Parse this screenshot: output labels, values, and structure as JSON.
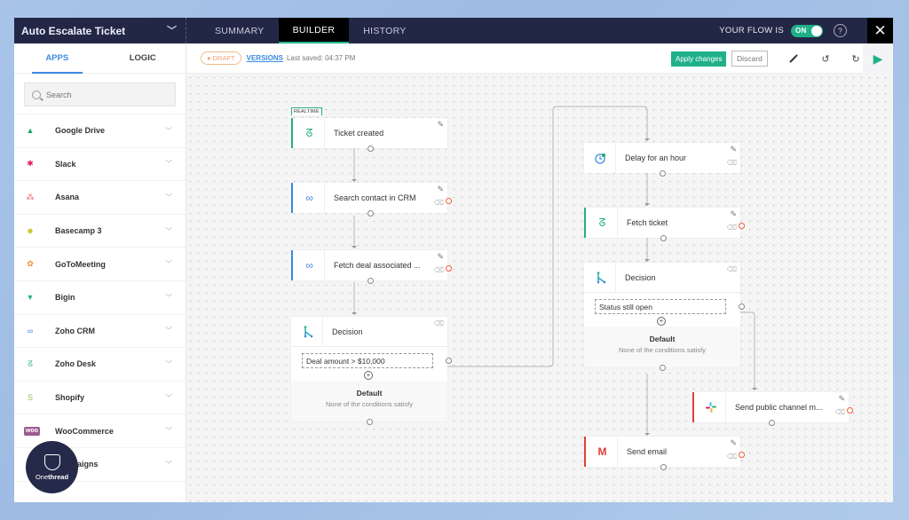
{
  "header": {
    "flow_name": "Auto Escalate Ticket",
    "tabs": [
      {
        "label": "SUMMARY",
        "active": false
      },
      {
        "label": "BUILDER",
        "active": true
      },
      {
        "label": "HISTORY",
        "active": false
      }
    ],
    "flow_status_label": "YOUR FLOW IS",
    "toggle_label": "ON",
    "toggle_on": true,
    "help_icon": "?",
    "close_icon": "✕"
  },
  "sidebar": {
    "tabs": [
      {
        "label": "APPS",
        "active": true
      },
      {
        "label": "LOGIC",
        "active": false
      }
    ],
    "search_placeholder": "Search",
    "apps": [
      {
        "label": "Google Drive",
        "icon": "google-drive-icon",
        "glyph": "▲",
        "color": "#1fa463"
      },
      {
        "label": "Slack",
        "icon": "slack-icon",
        "glyph": "✱",
        "color": "#e01e5a"
      },
      {
        "label": "Asana",
        "icon": "asana-icon",
        "glyph": "⁂",
        "color": "#f06a6a"
      },
      {
        "label": "Basecamp 3",
        "icon": "basecamp-icon",
        "glyph": "☻",
        "color": "#c7c21b"
      },
      {
        "label": "GoToMeeting",
        "icon": "gotomeeting-icon",
        "glyph": "✿",
        "color": "#f68d2e"
      },
      {
        "label": "Bigin",
        "icon": "bigin-icon",
        "glyph": "▼",
        "color": "#2fb574"
      },
      {
        "label": "Zoho CRM",
        "icon": "zoho-crm-icon",
        "glyph": "∞",
        "color": "#3b8be0"
      },
      {
        "label": "Zoho Desk",
        "icon": "zoho-desk-icon",
        "glyph": "ᘔ",
        "color": "#25b07a"
      },
      {
        "label": "Shopify",
        "icon": "shopify-icon",
        "glyph": "S",
        "color": "#95bf47"
      },
      {
        "label": "WooCommerce",
        "icon": "woocommerce-icon",
        "glyph": "woo",
        "color": "#9b5c8f"
      },
      {
        "label": "Campaigns",
        "icon": "campaigns-icon",
        "glyph": "●",
        "color": "#e0413a"
      }
    ]
  },
  "toolbar": {
    "draft_label": "● DRAFT",
    "versions_label": "VERSIONS",
    "last_saved": "Last saved: 04:37 PM",
    "apply_label": "Apply changes",
    "discard_label": "Discard",
    "magic_icon": "⁄",
    "undo_icon": "↺",
    "redo_icon": "↻",
    "run_icon": "▶"
  },
  "flow": {
    "trigger": {
      "tag": "REALTIME",
      "label": "Ticket created",
      "glyph": "ᘔ",
      "color": "#25b07a"
    },
    "nodes": [
      {
        "id": "search-contact",
        "label": "Search contact in CRM",
        "glyph": "∞",
        "color": "#3b8be0"
      },
      {
        "id": "fetch-deal",
        "label": "Fetch deal associated ...",
        "glyph": "∞",
        "color": "#3b8be0"
      },
      {
        "id": "delay",
        "label": "Delay for an hour",
        "glyph": "◔",
        "color": "#3b8be0"
      },
      {
        "id": "fetch-ticket",
        "label": "Fetch ticket",
        "glyph": "ᘔ",
        "color": "#25b07a"
      },
      {
        "id": "send-slack",
        "label": "Send public channel m...",
        "glyph": "✱",
        "color": "#e01e5a"
      },
      {
        "id": "send-email",
        "label": "Send email",
        "glyph": "M",
        "color": "#e0413a"
      }
    ],
    "decisions": [
      {
        "id": "decision-1",
        "label": "Decision",
        "condition": "Deal amount > $10,000",
        "default_title": "Default",
        "default_desc": "None of the conditions satisfy"
      },
      {
        "id": "decision-2",
        "label": "Decision",
        "condition": "Status still open",
        "default_title": "Default",
        "default_desc": "None of the conditions satisfy"
      }
    ],
    "edit_icon": "✎",
    "trash_icon": "🗑",
    "add_icon": "+"
  },
  "brand": {
    "name_light": "One",
    "name_bold": "thread"
  }
}
